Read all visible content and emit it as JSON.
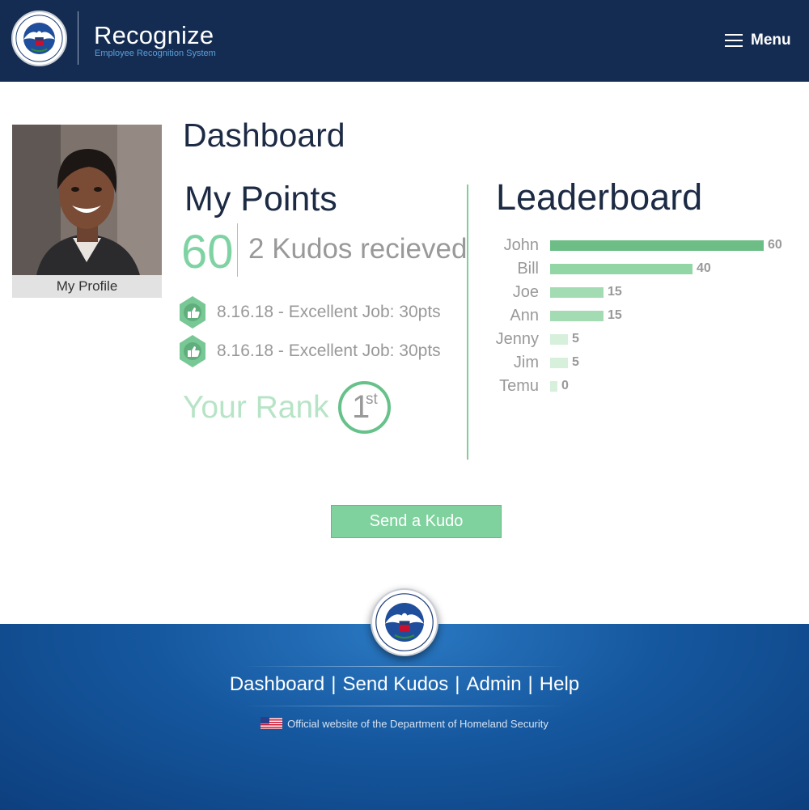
{
  "header": {
    "app_title": "Recognize",
    "app_subtitle": "Employee Recognition System",
    "menu_label": "Menu"
  },
  "profile": {
    "link_label": "My Profile"
  },
  "page_title": "Dashboard",
  "points": {
    "heading": "My Points",
    "value": "60",
    "kudos_summary": "2 Kudos recieved",
    "kudos": [
      {
        "text": "8.16.18 - Excellent Job: 30pts"
      },
      {
        "text": "8.16.18 - Excellent Job: 30pts"
      }
    ],
    "rank_label": "Your Rank",
    "rank_number": "1",
    "rank_suffix": "st"
  },
  "leaderboard": {
    "heading": "Leaderboard",
    "max": 60,
    "entries": [
      {
        "name": "John",
        "points": 60,
        "color": "#6dbd86"
      },
      {
        "name": "Bill",
        "points": 40,
        "color": "#93d6a6"
      },
      {
        "name": "Joe",
        "points": 15,
        "color": "#a3dcb2"
      },
      {
        "name": "Ann",
        "points": 15,
        "color": "#a3dcb2"
      },
      {
        "name": "Jenny",
        "points": 5,
        "color": "#d6f0dc"
      },
      {
        "name": "Jim",
        "points": 5,
        "color": "#d6f0dc"
      },
      {
        "name": "Temu",
        "points": 0,
        "color": "#d6f0dc"
      }
    ]
  },
  "send_button": "Send a Kudo",
  "footer": {
    "nav": [
      "Dashboard",
      "Send Kudos",
      "Admin",
      "Help"
    ],
    "separator": "|",
    "official_text": "Official website of the Department of Homeland Security"
  },
  "colors": {
    "header_bg": "#142c52",
    "accent_green": "#7fd29d",
    "footer_blue": "#15579e"
  }
}
